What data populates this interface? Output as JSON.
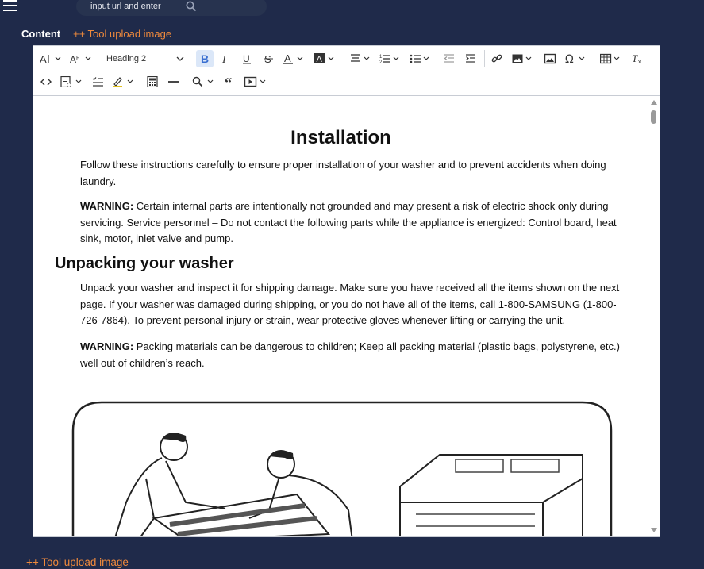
{
  "header": {
    "url_placeholder": "input url and enter"
  },
  "content_label": "Content",
  "upload_label": "++ Tool upload image",
  "toolbar": {
    "heading_value": "Heading 2"
  },
  "document": {
    "title": "Installation",
    "intro": "Follow these instructions carefully to ensure proper installation of your washer and to prevent accidents when doing laundry.",
    "warning1_label": "WARNING:",
    "warning1_text": " Certain internal parts are intentionally not grounded and may present a risk of electric shock only during servicing. Service personnel – Do not contact the following parts while the appliance is energized: Control board, heat sink, motor, inlet valve and pump.",
    "section_title": "Unpacking your washer",
    "unpack_text": "Unpack your washer and inspect it for shipping damage. Make sure you have received all the items shown on the next page. If your washer was damaged during shipping, or you do not have all of the items, call 1-800-SAMSUNG (1-800-726-7864). To prevent personal injury or strain, wear protective gloves whenever lifting or carrying the unit.",
    "warning2_label": "WARNING:",
    "warning2_text": " Packing materials can be dangerous to children; Keep all packing material (plastic bags, polystyrene, etc.) well out of children’s reach."
  },
  "colors": {
    "background": "#1f2a4a",
    "accent_link": "#f08a3c",
    "active_button": "#dbe7f8"
  }
}
